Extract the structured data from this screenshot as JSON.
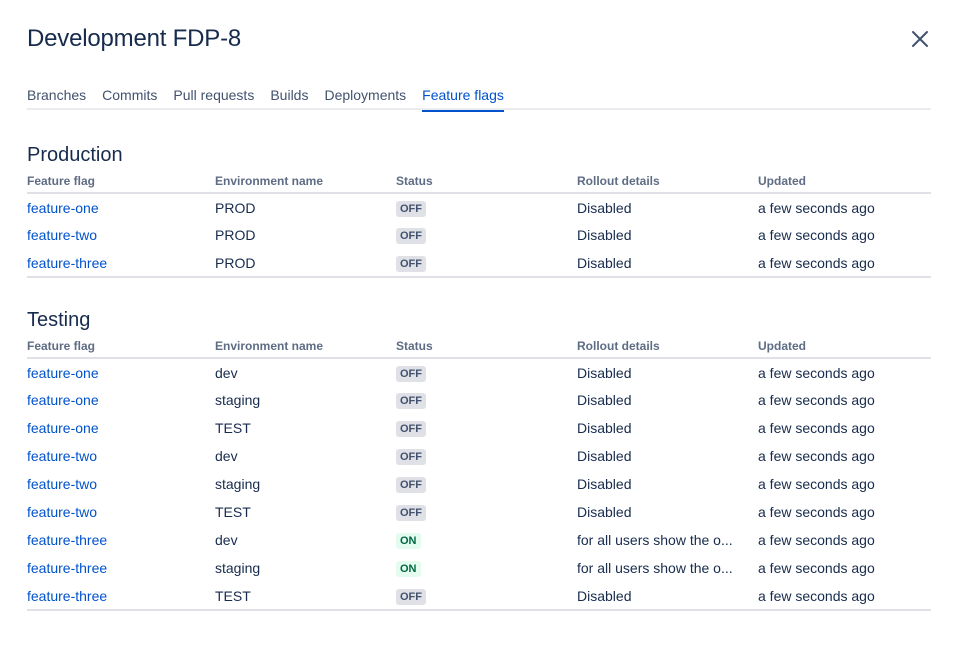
{
  "dialog": {
    "title": "Development FDP-8",
    "close_icon": "close-icon"
  },
  "tabs": [
    {
      "label": "Branches",
      "active": false
    },
    {
      "label": "Commits",
      "active": false
    },
    {
      "label": "Pull requests",
      "active": false
    },
    {
      "label": "Builds",
      "active": false
    },
    {
      "label": "Deployments",
      "active": false
    },
    {
      "label": "Feature flags",
      "active": true
    }
  ],
  "columns": [
    "Feature flag",
    "Environment name",
    "Status",
    "Rollout details",
    "Updated"
  ],
  "colors": {
    "link": "#0052cc",
    "status_off_bg": "#dfe1e6",
    "status_on_bg": "#e3fcef",
    "status_on_text": "#006644"
  },
  "sections": [
    {
      "title": "Production",
      "rows": [
        {
          "flag": "feature-one",
          "env": "PROD",
          "status": "OFF",
          "rollout": "Disabled",
          "updated": "a few seconds ago"
        },
        {
          "flag": "feature-two",
          "env": "PROD",
          "status": "OFF",
          "rollout": "Disabled",
          "updated": "a few seconds ago"
        },
        {
          "flag": "feature-three",
          "env": "PROD",
          "status": "OFF",
          "rollout": "Disabled",
          "updated": "a few seconds ago"
        }
      ]
    },
    {
      "title": "Testing",
      "rows": [
        {
          "flag": "feature-one",
          "env": "dev",
          "status": "OFF",
          "rollout": "Disabled",
          "updated": "a few seconds ago"
        },
        {
          "flag": "feature-one",
          "env": "staging",
          "status": "OFF",
          "rollout": "Disabled",
          "updated": "a few seconds ago"
        },
        {
          "flag": "feature-one",
          "env": "TEST",
          "status": "OFF",
          "rollout": "Disabled",
          "updated": "a few seconds ago"
        },
        {
          "flag": "feature-two",
          "env": "dev",
          "status": "OFF",
          "rollout": "Disabled",
          "updated": "a few seconds ago"
        },
        {
          "flag": "feature-two",
          "env": "staging",
          "status": "OFF",
          "rollout": "Disabled",
          "updated": "a few seconds ago"
        },
        {
          "flag": "feature-two",
          "env": "TEST",
          "status": "OFF",
          "rollout": "Disabled",
          "updated": "a few seconds ago"
        },
        {
          "flag": "feature-three",
          "env": "dev",
          "status": "ON",
          "rollout": "for all users show the o...",
          "updated": "a few seconds ago"
        },
        {
          "flag": "feature-three",
          "env": "staging",
          "status": "ON",
          "rollout": "for all users show the o...",
          "updated": "a few seconds ago"
        },
        {
          "flag": "feature-three",
          "env": "TEST",
          "status": "OFF",
          "rollout": "Disabled",
          "updated": "a few seconds ago"
        }
      ]
    }
  ]
}
